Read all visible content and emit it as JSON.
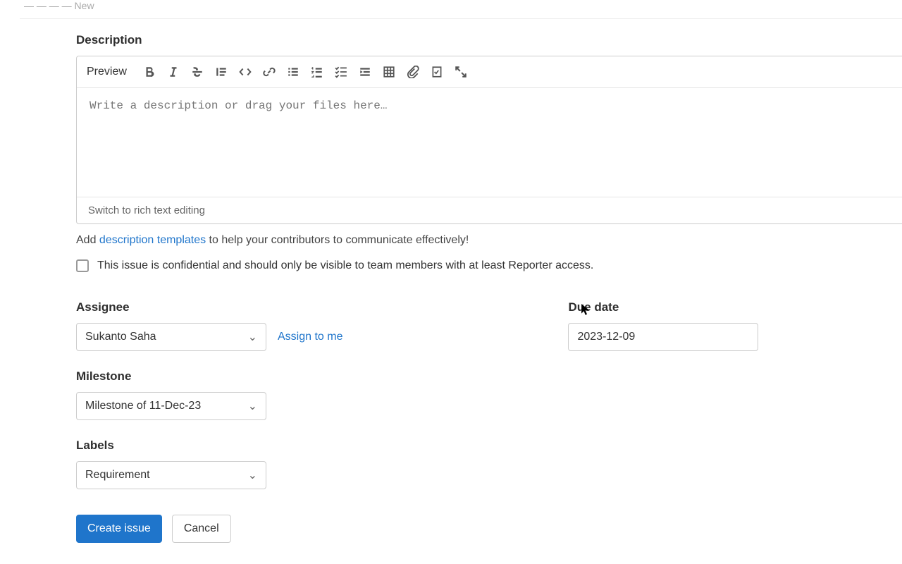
{
  "breadcrumb": {
    "raw": "— — — — New"
  },
  "description": {
    "label": "Description",
    "preview": "Preview",
    "placeholder": "Write a description or drag your files here…",
    "footer": "Switch to rich text editing"
  },
  "hint": {
    "prefix": "Add ",
    "link": "description templates",
    "suffix": " to help your contributors to communicate effectively!"
  },
  "confidential": {
    "label": "This issue is confidential and should only be visible to team members with at least Reporter access."
  },
  "assignee": {
    "label": "Assignee",
    "value": "Sukanto Saha",
    "assign_to_me": "Assign to me"
  },
  "due_date": {
    "label": "Due date",
    "value": "2023-12-09"
  },
  "milestone": {
    "label": "Milestone",
    "value": "Milestone of 11-Dec-23"
  },
  "labels": {
    "label": "Labels",
    "value": "Requirement"
  },
  "actions": {
    "create": "Create issue",
    "cancel": "Cancel"
  }
}
